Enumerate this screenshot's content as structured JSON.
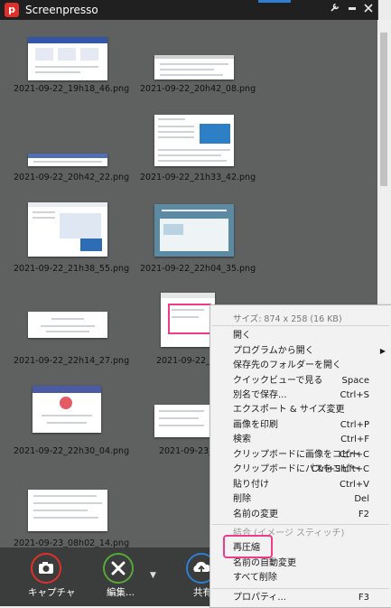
{
  "app": {
    "title": "Screenpresso",
    "logo_letter": "p",
    "tool_icon": "wrench-icon",
    "minimize_icon": "minimize-icon",
    "close_icon": "close-icon",
    "accent": "#e0302c"
  },
  "thumbnails": [
    {
      "filename": "2021-09-22_19h18_46.png"
    },
    {
      "filename": "2021-09-22_20h42_08.png"
    },
    {
      "filename": "2021-09-22_20h42_22.png"
    },
    {
      "filename": "2021-09-22_21h33_42.png"
    },
    {
      "filename": "2021-09-22_21h38_55.png"
    },
    {
      "filename": "2021-09-22_22h04_35.png"
    },
    {
      "filename": "2021-09-22_22h14_27.png"
    },
    {
      "filename": "2021-09-22_22h1"
    },
    {
      "filename": "2021-09-22_22h30_04.png"
    },
    {
      "filename": "2021-09-23_08h"
    },
    {
      "filename": "2021-09-23_08h02_14.png"
    }
  ],
  "toolbar": {
    "capture_label": "キャプチャ",
    "edit_label": "編集...",
    "share_label": "共有",
    "dropdown_icon": "triangle-down-icon"
  },
  "context_menu": {
    "header": "サイズ: 874 x 258 (16 KB)",
    "items": [
      {
        "label": "開く",
        "shortcut": ""
      },
      {
        "label": "プログラムから開く",
        "shortcut": ""
      },
      {
        "label": "保存先のフォルダーを開く",
        "shortcut": ""
      },
      {
        "label": "クイックビューで見る",
        "shortcut": "Space"
      },
      {
        "label": "別名で保存...",
        "shortcut": "Ctrl+S"
      },
      {
        "label": "エクスポート & サイズ変更",
        "shortcut": ""
      },
      {
        "label": "画像を印刷",
        "shortcut": "Ctrl+P"
      },
      {
        "label": "検索",
        "shortcut": "Ctrl+F"
      },
      {
        "label": "クリップボードに画像をコピー",
        "shortcut": "Ctrl+C"
      },
      {
        "label": "クリップボードにパスをコピー",
        "shortcut": "Ctrl+Shift+C"
      },
      {
        "label": "貼り付け",
        "shortcut": "Ctrl+V"
      },
      {
        "label": "削除",
        "shortcut": "Del"
      },
      {
        "label": "名前の変更",
        "shortcut": "F2"
      },
      {
        "label": "結合 (イメージ スティッチ)",
        "shortcut": ""
      },
      {
        "label": "再圧縮",
        "shortcut": ""
      },
      {
        "label": "名前の自動変更",
        "shortcut": ""
      },
      {
        "label": "すべて削除",
        "shortcut": ""
      },
      {
        "label": "プロパティ...",
        "shortcut": "F3"
      }
    ]
  }
}
